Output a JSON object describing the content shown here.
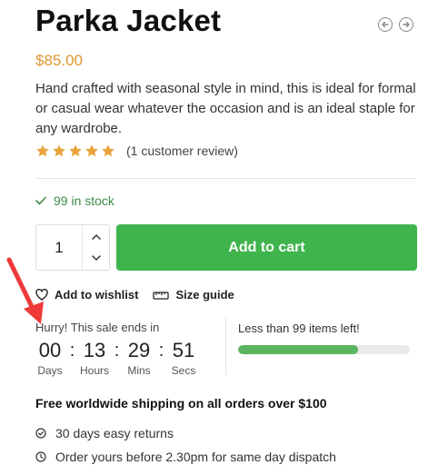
{
  "product": {
    "title": "Parka Jacket",
    "price": "$85.00",
    "description": "Hand crafted with seasonal style in mind, this is ideal for formal or casual wear whatever the occasion and is an ideal staple for any wardrobe.",
    "rating": {
      "stars": 5,
      "max": 5,
      "review_text": "(1 customer review)"
    },
    "stock": "99 in stock"
  },
  "nav": {
    "prev_icon": "arrow-left-circle-icon",
    "next_icon": "arrow-right-circle-icon"
  },
  "cart": {
    "quantity": "1",
    "add_label": "Add to cart"
  },
  "links": {
    "wishlist": "Add to wishlist",
    "size_guide": "Size guide"
  },
  "sale": {
    "headline": "Hurry! This sale ends in",
    "countdown": [
      {
        "value": "00",
        "label": "Days"
      },
      {
        "value": "13",
        "label": "Hours"
      },
      {
        "value": "29",
        "label": "Mins"
      },
      {
        "value": "51",
        "label": "Secs"
      }
    ],
    "separator": ":",
    "items_left_text": "Less than 99 items left!",
    "items_progress": 0.7
  },
  "shipping": {
    "headline": "Free worldwide shipping on all orders over $100",
    "perks": [
      "30 days easy returns",
      "Order yours before 2.30pm for same day dispatch"
    ]
  },
  "colors": {
    "accent": "#3fb44c",
    "price": "#e0962e",
    "star": "#e8a33a",
    "stock": "#3c8a48",
    "annotation": "#ee3a3a"
  }
}
